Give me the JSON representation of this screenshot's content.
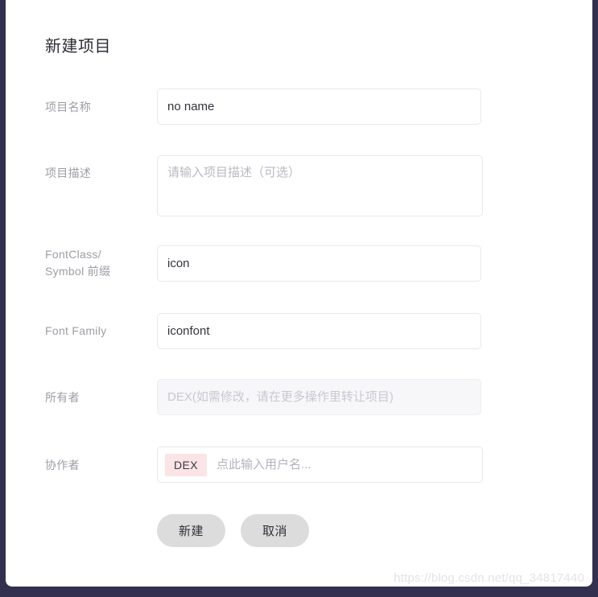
{
  "dialog": {
    "title": "新建项目",
    "fields": [
      {
        "key": "project_name",
        "label": "项目名称",
        "value": "no name",
        "placeholder": ""
      },
      {
        "key": "project_description",
        "label": "项目描述",
        "value": "",
        "placeholder": "请输入项目描述（可选）"
      },
      {
        "key": "fontclass_prefix",
        "label_line1": "FontClass/",
        "label_line2": "Symbol 前缀",
        "label": "FontClass/Symbol 前缀",
        "value": "icon",
        "placeholder": ""
      },
      {
        "key": "font_family",
        "label": "Font Family",
        "value": "iconfont",
        "placeholder": ""
      },
      {
        "key": "owner",
        "label": "所有者",
        "value": "",
        "placeholder": "DEX(如需修改，请在更多操作里转让项目)"
      },
      {
        "key": "collaborators",
        "label": "协作者",
        "tag": "DEX",
        "value": "",
        "placeholder": "点此输入用户名..."
      }
    ],
    "buttons": {
      "submit": "新建",
      "cancel": "取消"
    }
  },
  "watermark": "https://blog.csdn.net/qq_34817440",
  "colors": {
    "backdrop": "#332f4e",
    "card": "#ffffff",
    "label": "#9d9da5",
    "border": "#e9e9ec",
    "disabled_bg": "#f7f7f9",
    "tag_bg": "#fbe4e6",
    "button_bg": "#dcdcdc",
    "title": "#2c2c35",
    "watermark": "#e3e3e8"
  }
}
